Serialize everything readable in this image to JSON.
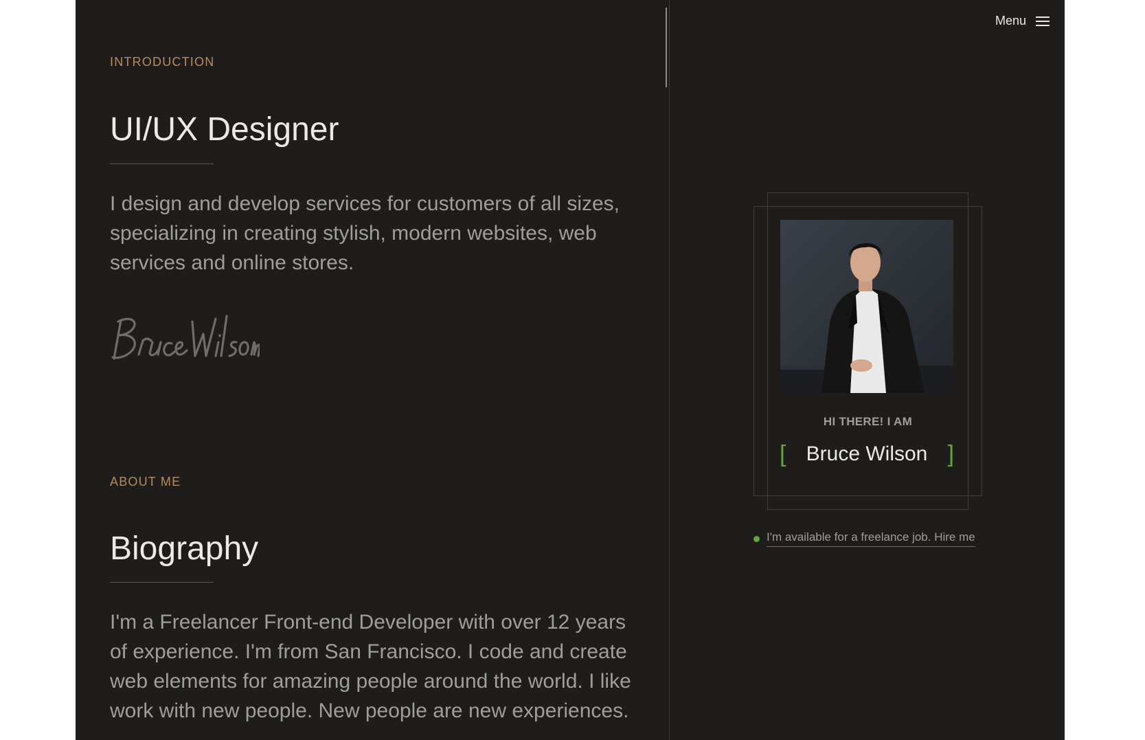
{
  "menu": {
    "label": "Menu",
    "icon": "hamburger-icon"
  },
  "intro": {
    "eyebrow": "INTRODUCTION",
    "title": "UI/UX Designer",
    "description": "I design and develop services for customers of all sizes, specializing in creating stylish, modern websites, web services and online stores.",
    "signature": "Bruce Wilson"
  },
  "about": {
    "eyebrow": "ABOUT ME",
    "title": "Biography",
    "description": "I'm a Freelancer Front-end Developer with over 12 years of experience. I'm from San Francisco. I code and create web elements for amazing people around the world. I like work with new people. New people are new experiences."
  },
  "profile": {
    "greeting": "HI THERE! I AM",
    "name": "Bruce Wilson",
    "bracket_left": "[",
    "bracket_right": "]",
    "availability": "I'm available for a freelance job. Hire me"
  },
  "colors": {
    "background": "#1e1d1c",
    "accent_gold": "#b58c5e",
    "accent_green": "#5fa83c",
    "text_light": "#eceae6",
    "text_muted": "#a09e9a"
  }
}
